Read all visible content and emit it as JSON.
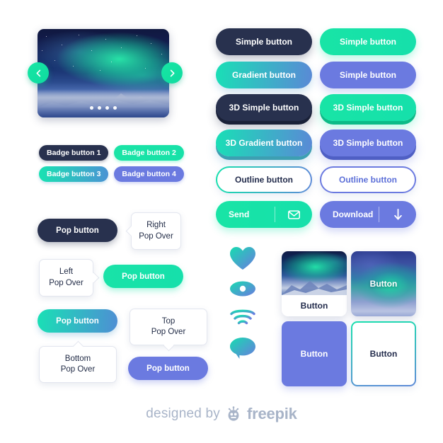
{
  "carousel": {
    "name": "image-carousel",
    "prev_icon": "chevron-left-icon",
    "next_icon": "chevron-right-icon",
    "dot_count": 4,
    "active_dot": 0,
    "image_alt": "aurora borealis over snowy mountains"
  },
  "badges": [
    {
      "label": "Badge button 1",
      "style": "dark"
    },
    {
      "label": "Badge button 2",
      "style": "green"
    },
    {
      "label": "Badge button 3",
      "style": "gradient"
    },
    {
      "label": "Badge button 4",
      "style": "blue"
    }
  ],
  "popovers": {
    "pop_button_label": "Pop button",
    "right": {
      "line1": "Right",
      "line2": "Pop Over"
    },
    "left": {
      "line1": "Left",
      "line2": "Pop Over"
    },
    "top": {
      "line1": "Top",
      "line2": "Pop Over"
    },
    "bottom": {
      "line1": "Bottom",
      "line2": "Pop Over"
    }
  },
  "right_buttons": {
    "simple_dark": "Simple button",
    "simple_green": "Simple button",
    "gradient": "Gradient button",
    "simple_blue": "Simple button",
    "td_simple_dark": "3D Simple button",
    "td_simple_green": "3D Simple button",
    "td_gradient": "3D Gradient button",
    "td_simple_blue": "3D Simple button",
    "outline_green": "Outline button",
    "outline_blue": "Outline button",
    "send": "Send",
    "send_icon": "envelope-icon",
    "download": "Download",
    "download_icon": "arrow-down-icon"
  },
  "icons": [
    {
      "name": "heart-icon"
    },
    {
      "name": "eye-icon"
    },
    {
      "name": "wifi-icon"
    },
    {
      "name": "chat-bubble-icon"
    }
  ],
  "cards": {
    "photo_label": "Button",
    "photo_overlay": "Button",
    "solid": "Button",
    "outline": "Button"
  },
  "footer": {
    "text": "designed by",
    "brand": "freepik",
    "logo_icon": "freepik-robot-icon"
  },
  "colors": {
    "dark": "#28314e",
    "green": "#18e3a8",
    "blue": "#6b7ae0",
    "gradient_start": "#19e0b5",
    "gradient_end": "#5a89d6",
    "footer_gray": "#a8b4c8"
  }
}
